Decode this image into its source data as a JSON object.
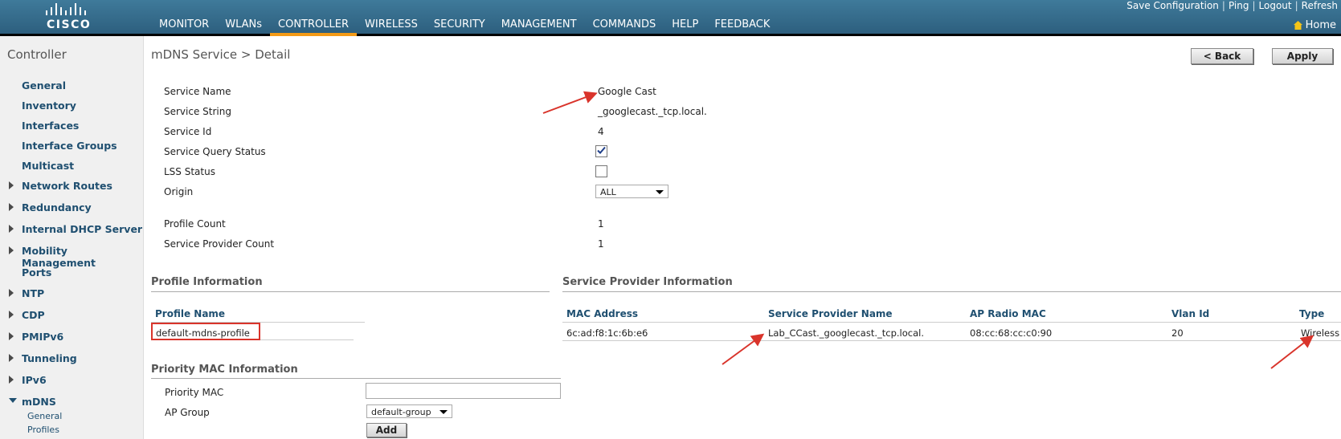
{
  "header": {
    "logo_text": "CISCO",
    "nav": [
      "MONITOR",
      "WLANs",
      "CONTROLLER",
      "WIRELESS",
      "SECURITY",
      "MANAGEMENT",
      "COMMANDS",
      "HELP",
      "FEEDBACK"
    ],
    "active_nav": "CONTROLLER",
    "top_links": [
      "Save Configuration",
      "Ping",
      "Logout",
      "Refresh"
    ],
    "home": "Home"
  },
  "sidebar": {
    "title": "Controller",
    "items": [
      "General",
      "Inventory",
      "Interfaces",
      "Interface Groups",
      "Multicast",
      "Network Routes",
      "Redundancy",
      "Internal DHCP Server",
      "Mobility Management",
      "Ports",
      "NTP",
      "CDP",
      "PMIPv6",
      "Tunneling",
      "IPv6",
      "mDNS"
    ],
    "mdns_sub": [
      "General",
      "Profiles"
    ]
  },
  "page": {
    "title": "mDNS Service > Detail",
    "back_button": "< Back",
    "apply_button": "Apply"
  },
  "form": {
    "service_name_label": "Service Name",
    "service_name": "Google Cast",
    "service_string_label": "Service String",
    "service_string": "_googlecast._tcp.local.",
    "service_id_label": "Service Id",
    "service_id": "4",
    "query_status_label": "Service Query Status",
    "query_status_checked": true,
    "lss_label": "LSS Status",
    "lss_checked": false,
    "origin_label": "Origin",
    "origin": "ALL",
    "profile_count_label": "Profile Count",
    "profile_count": "1",
    "sp_count_label": "Service Provider Count",
    "sp_count": "1"
  },
  "profile_info": {
    "title": "Profile Information",
    "col_name": "Profile Name",
    "rows": [
      "default-mdns-profile"
    ]
  },
  "sp_info": {
    "title": "Service Provider Information",
    "columns": [
      "MAC Address",
      "Service Provider Name",
      "AP Radio MAC",
      "Vlan Id",
      "Type"
    ],
    "rows": [
      [
        "6c:ad:f8:1c:6b:e6",
        "Lab_CCast._googlecast._tcp.local.",
        "08:cc:68:cc:c0:90",
        "20",
        "Wireless"
      ]
    ]
  },
  "priority": {
    "title": "Priority MAC Information",
    "mac_label": "Priority MAC",
    "mac_value": "",
    "group_label": "AP Group",
    "group_value": "default-group",
    "add_button": "Add"
  },
  "colors": {
    "accent": "#f39a16",
    "nav_bg": "#336a8a",
    "link": "#1f4f70",
    "annotation": "#d9342b"
  }
}
